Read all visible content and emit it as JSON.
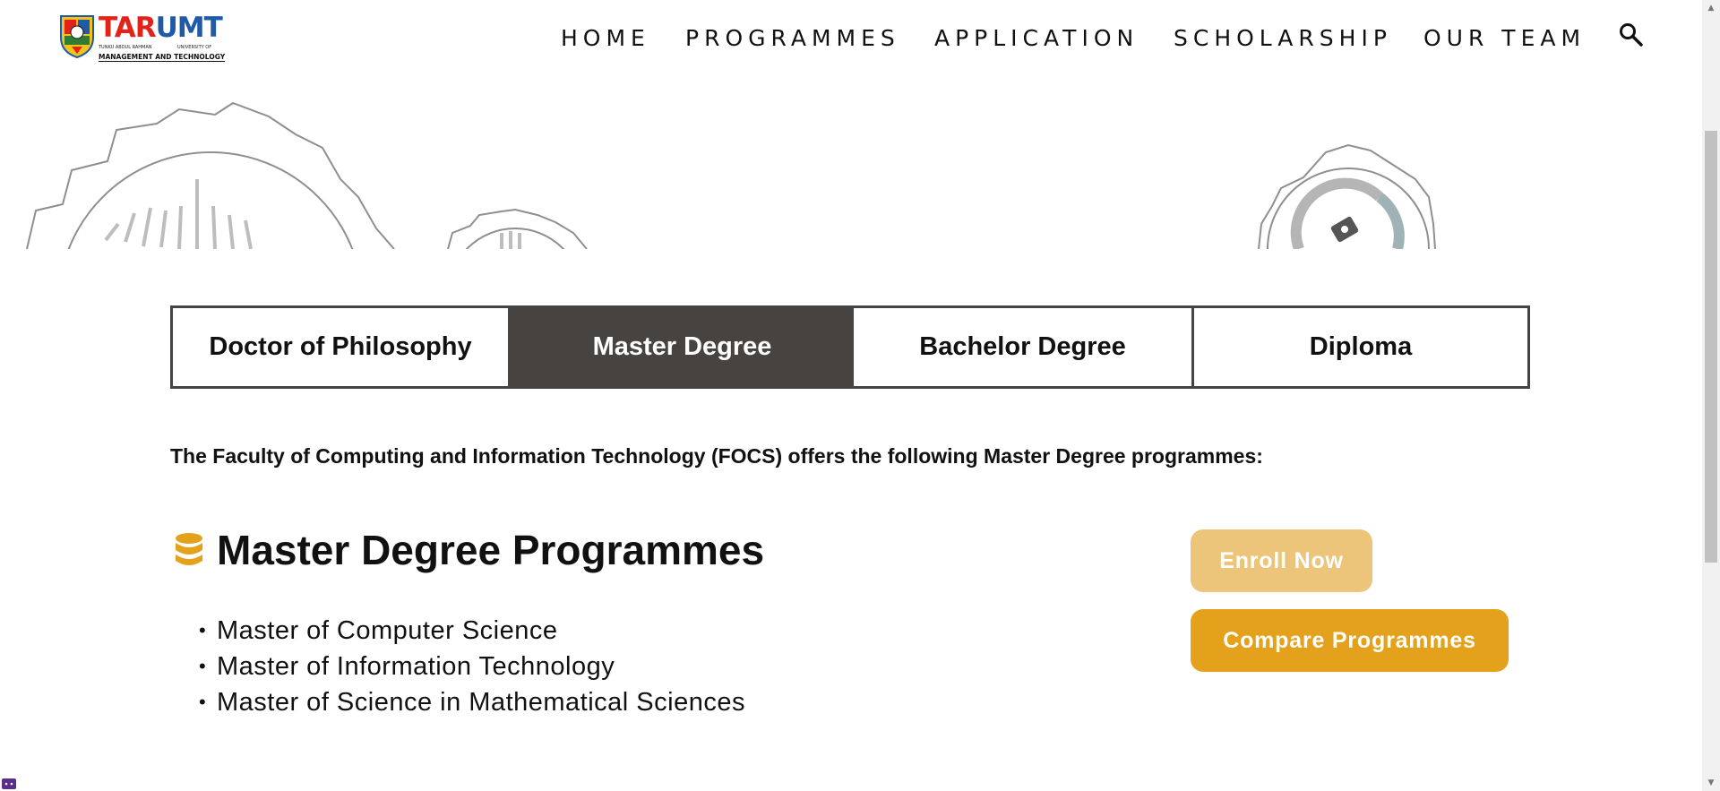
{
  "brand": {
    "logo_text_left": "TAR",
    "logo_text_right": "UMT",
    "subtitle_left": "TUNKU ABDUL RAHMAN",
    "subtitle_right": "UNIVERSITY OF",
    "tagline": "MANAGEMENT AND TECHNOLOGY",
    "colors": {
      "red": "#e2231a",
      "blue": "#1e5aa8"
    }
  },
  "nav": {
    "items": [
      {
        "label": "HOME"
      },
      {
        "label": "PROGRAMMES"
      },
      {
        "label": "APPLICATION"
      },
      {
        "label": "SCHOLARSHIP"
      },
      {
        "label": "OUR TEAM"
      }
    ],
    "search_icon": "search-icon"
  },
  "tabs": {
    "items": [
      {
        "label": "Doctor of Philosophy",
        "active": false
      },
      {
        "label": "Master Degree",
        "active": true
      },
      {
        "label": "Bachelor Degree",
        "active": false
      },
      {
        "label": "Diploma",
        "active": false
      }
    ],
    "active_color": "#474341"
  },
  "intro": "The Faculty of Computing and Information Technology (FOCS) offers the following Master Degree programmes:",
  "programmes": {
    "icon": "database-icon",
    "title": "Master Degree Programmes",
    "items": [
      "Master of Computer Science",
      "Master of Information Technology",
      "Master of Science in Mathematical Sciences"
    ]
  },
  "actions": {
    "enroll_label": "Enroll Now",
    "compare_label": "Compare Programmes",
    "accent": "#e4a11b",
    "accent_light": "#ecc57a"
  }
}
